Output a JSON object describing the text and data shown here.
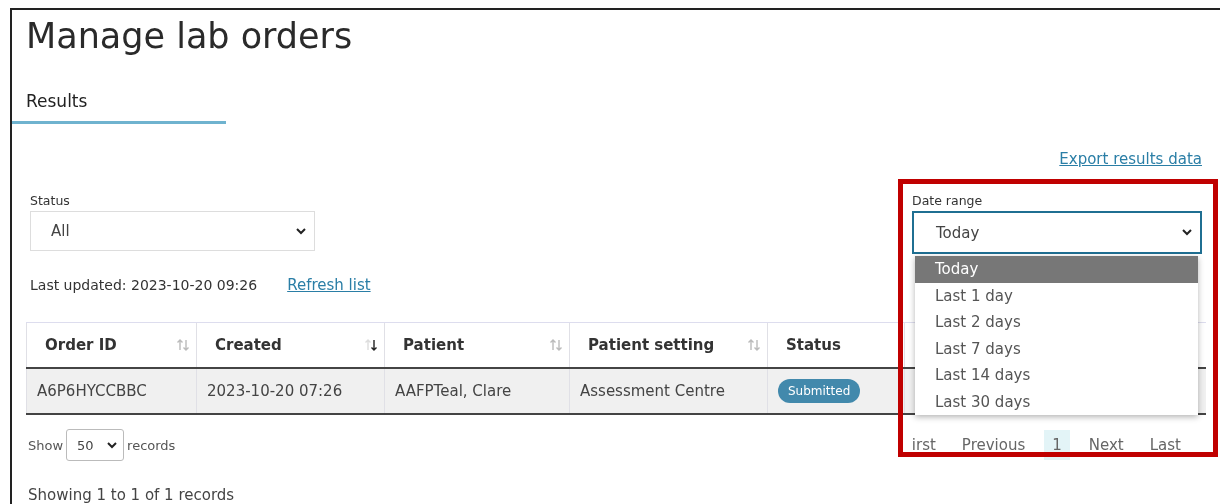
{
  "page": {
    "title": "Manage lab orders"
  },
  "tabs": [
    {
      "label": "Results",
      "selected": true
    }
  ],
  "export_link": "Export results data",
  "status_filter": {
    "label": "Status",
    "value": "All"
  },
  "date_range": {
    "label": "Date range",
    "value": "Today",
    "expanded": true,
    "options": [
      {
        "label": "Today",
        "selected": true
      },
      {
        "label": "Last 1 day",
        "selected": false
      },
      {
        "label": "Last 2 days",
        "selected": false
      },
      {
        "label": "Last 7 days",
        "selected": false
      },
      {
        "label": "Last 14 days",
        "selected": false
      },
      {
        "label": "Last 30 days",
        "selected": false
      }
    ]
  },
  "last_updated": {
    "label": "Last updated:",
    "value": "2023-10-20 09:26"
  },
  "refresh_link": "Refresh list",
  "table": {
    "columns": [
      {
        "label": "Order ID",
        "sort_icon": true,
        "sorted_desc": false
      },
      {
        "label": "Created",
        "sort_icon": true,
        "sorted_desc": true
      },
      {
        "label": "Patient",
        "sort_icon": true,
        "sorted_desc": false
      },
      {
        "label": "Patient setting",
        "sort_icon": true,
        "sorted_desc": false
      },
      {
        "label": "Status",
        "sort_icon": false
      }
    ],
    "rows": [
      {
        "cells": [
          "A6P6HYCCBBC",
          "2023-10-20 07:26",
          "AAFPTeal, Clare",
          "Assessment Centre"
        ],
        "status": "Submitted"
      }
    ]
  },
  "page_size": {
    "before": "Show",
    "value": "50",
    "after": "records"
  },
  "pagination": [
    {
      "label": "irst",
      "selected": false
    },
    {
      "label": "Previous",
      "selected": false
    },
    {
      "label": "1",
      "selected": true
    },
    {
      "label": "Next",
      "selected": false
    },
    {
      "label": "Last",
      "selected": false
    }
  ],
  "summary": "Showing 1 to 1 of 1 records",
  "highlight_frame": true
}
